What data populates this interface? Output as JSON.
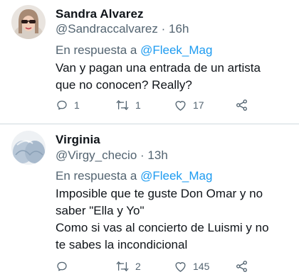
{
  "tweets": [
    {
      "name": "Sandra Alvarez",
      "handle": "@Sandraccalvarez",
      "separator": "·",
      "time": "16h",
      "reply_prefix": "En respuesta a",
      "reply_to": "@Fleek_Mag",
      "lines": [
        "Van y pagan una entrada de un artista",
        "que no conocen? Really?"
      ],
      "replies": "1",
      "retweets": "1",
      "likes": "17"
    },
    {
      "name": "Virginia",
      "handle": "@Virgy_checio",
      "separator": "·",
      "time": "13h",
      "reply_prefix": "En respuesta a",
      "reply_to": "@Fleek_Mag",
      "lines": [
        "Imposible que te guste Don Omar y no",
        "saber \"Ella y Yo\"",
        "Como si vas al concierto de Luismi y no",
        "te sabes la incondicional"
      ],
      "replies": "",
      "retweets": "2",
      "likes": "145"
    }
  ],
  "colors": {
    "text": "#0f1419",
    "secondary": "#536471",
    "link": "#1d9bf0",
    "divider": "#cfd9de"
  },
  "icons": [
    "reply-icon",
    "retweet-icon",
    "like-icon",
    "share-icon"
  ]
}
